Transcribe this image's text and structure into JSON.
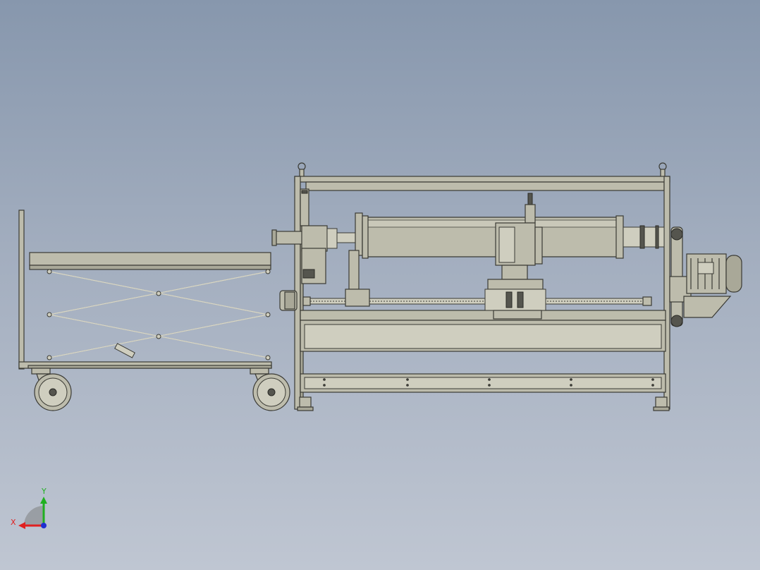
{
  "viewport": {
    "background_top": "#8797ad",
    "background_bottom": "#bfc6d2",
    "part_color": "#bdbcac"
  },
  "triad": {
    "x_label": "X",
    "y_label": "Y",
    "x_color": "#e02020",
    "y_color": "#20b020",
    "z_color": "#2030d0"
  }
}
